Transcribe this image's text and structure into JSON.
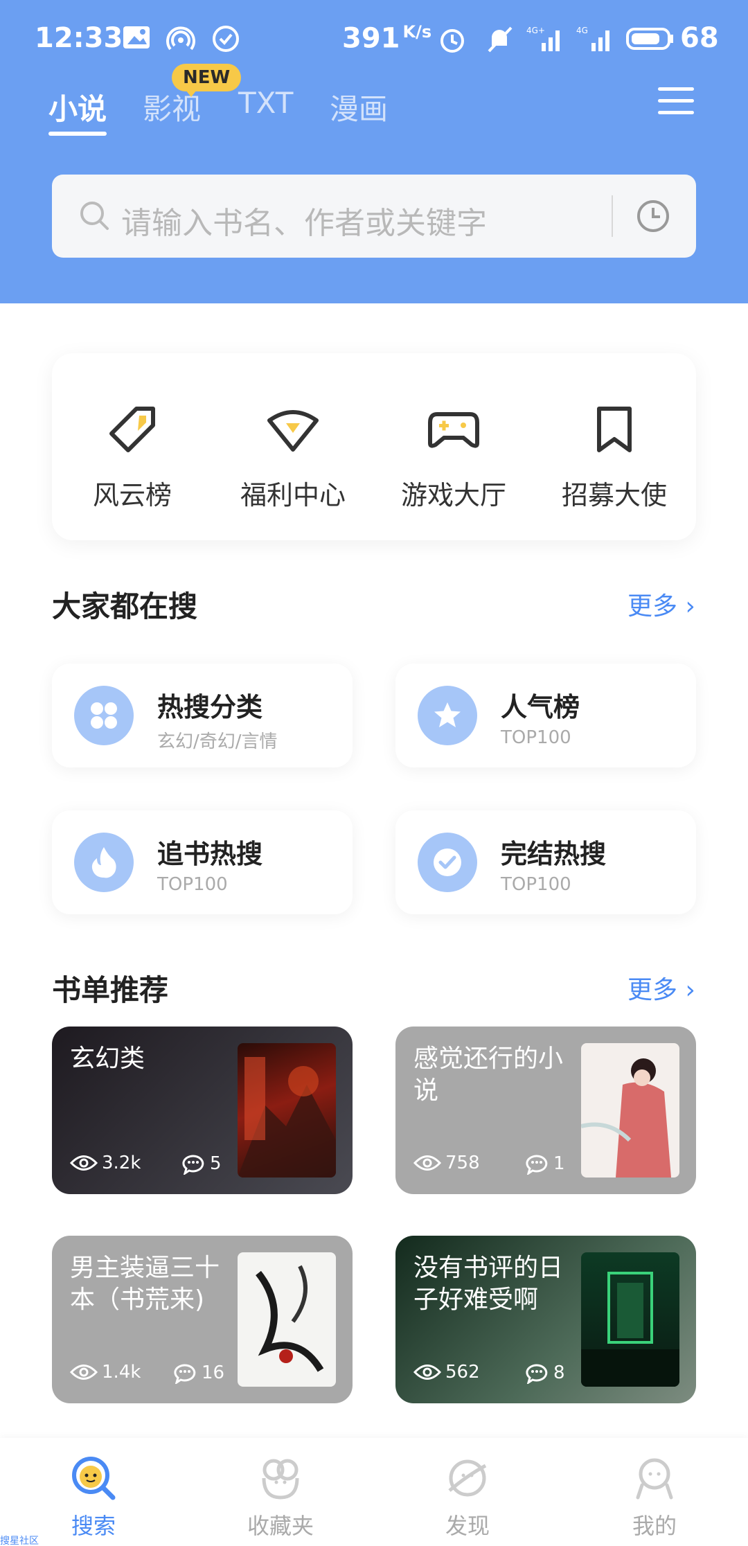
{
  "status_bar": {
    "time": "12:33",
    "speed": "391",
    "speed_unit": "K/s",
    "battery": "68"
  },
  "tabs": [
    {
      "label": "小说",
      "active": true
    },
    {
      "label": "影视",
      "active": false
    },
    {
      "label": "TXT",
      "active": false
    },
    {
      "label": "漫画",
      "active": false
    }
  ],
  "new_badge": "NEW",
  "search": {
    "placeholder": "请输入书名、作者或关键字"
  },
  "quick_links": [
    {
      "label": "风云榜",
      "icon": "tag-icon"
    },
    {
      "label": "福利中心",
      "icon": "gift-icon"
    },
    {
      "label": "游戏大厅",
      "icon": "gamepad-icon"
    },
    {
      "label": "招募大使",
      "icon": "bookmark-icon"
    }
  ],
  "popular": {
    "title": "大家都在搜",
    "more": "更多",
    "items": [
      {
        "title": "热搜分类",
        "subtitle": "玄幻/奇幻/言情",
        "icon": "grid-icon"
      },
      {
        "title": "人气榜",
        "subtitle": "TOP100",
        "icon": "star-icon"
      },
      {
        "title": "追书热搜",
        "subtitle": "TOP100",
        "icon": "flame-icon"
      },
      {
        "title": "完结热搜",
        "subtitle": "TOP100",
        "icon": "check-icon"
      }
    ]
  },
  "booklists": {
    "title": "书单推荐",
    "more": "更多",
    "items": [
      {
        "title": "玄幻类",
        "views": "3.2k",
        "comments": "5"
      },
      {
        "title": "感觉还行的小说",
        "views": "758",
        "comments": "1"
      },
      {
        "title": "男主装逼三十本（书荒来)",
        "views": "1.4k",
        "comments": "16"
      },
      {
        "title": "没有书评的日子好难受啊",
        "views": "562",
        "comments": "8"
      }
    ]
  },
  "bottom_nav": [
    {
      "label": "搜索",
      "active": true
    },
    {
      "label": "收藏夹",
      "active": false
    },
    {
      "label": "发现",
      "active": false
    },
    {
      "label": "我的",
      "active": false
    }
  ],
  "colors": {
    "header_bg": "#6b9ff2",
    "accent": "#4a8af4",
    "badge": "#f7c948"
  }
}
